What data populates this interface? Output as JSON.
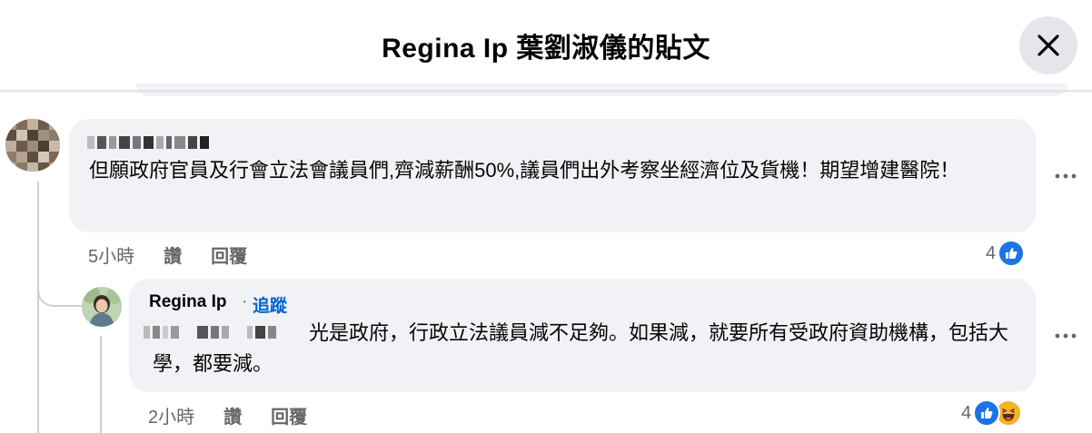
{
  "header": {
    "title": "Regina Ip 葉劉淑儀的貼文",
    "close_icon": "close-icon"
  },
  "comment": {
    "text": "但願政府官員及行會立法會議員們,齊減薪酬50%,議員們出外考察坐經濟位及貨機！期望增建醫院！",
    "time": "5小時",
    "like_label": "讚",
    "reply_label": "回覆",
    "reaction_count": "4",
    "reactions": [
      "like"
    ],
    "more_icon": "more-horizontal-icon"
  },
  "reply": {
    "author": "Regina Ip",
    "separator": "·",
    "follow_label": "追蹤",
    "text": "光是政府，行政立法議員減不足夠。如果減，就要所有受政府資助機構，包括大學，都要減。",
    "time": "2小時",
    "like_label": "讚",
    "reply_label": "回覆",
    "reaction_count": "4",
    "reactions": [
      "like",
      "haha"
    ],
    "more_icon": "more-horizontal-icon"
  },
  "colors": {
    "bubble": "#f0f2f5",
    "accent": "#0064d1",
    "like": "#1b74e4",
    "haha": "#f7b125",
    "secondary_text": "#65676b"
  }
}
